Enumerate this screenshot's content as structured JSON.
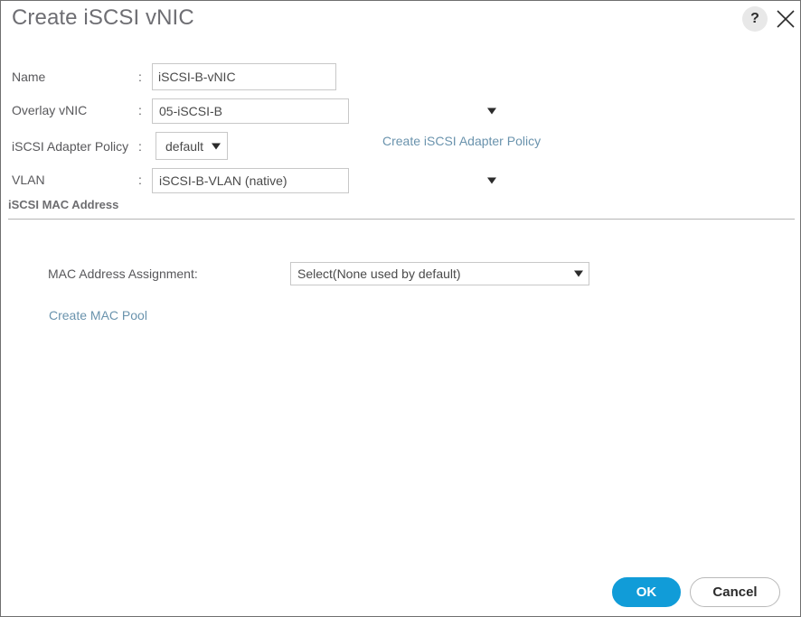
{
  "dialog": {
    "title": "Create iSCSI vNIC",
    "help_icon_glyph": "?",
    "help_icon_name": "question-mark-icon",
    "close_icon_name": "close-icon"
  },
  "form": {
    "colon": ":",
    "name": {
      "label": "Name",
      "value": "iSCSI-B-vNIC",
      "placeholder": ""
    },
    "overlay_vnic": {
      "label": "Overlay vNIC",
      "value": "05-iSCSI-B"
    },
    "adapter_policy": {
      "label": "iSCSI Adapter Policy",
      "value": "default"
    },
    "vlan": {
      "label": "VLAN",
      "value": "iSCSI-B-VLAN (native)"
    },
    "adapter_policy_link": "Create iSCSI Adapter Policy"
  },
  "mac_section": {
    "title": "iSCSI MAC Address",
    "assignment_label": "MAC Address Assignment:",
    "assignment_value": "Select(None used by default)",
    "create_pool_link": "Create MAC Pool"
  },
  "footer": {
    "ok_label": "OK",
    "cancel_label": "Cancel"
  },
  "colors": {
    "accent_blue": "#119cd8",
    "link_blue": "#6a93ad",
    "label_gray": "#58585b",
    "title_gray": "#6e6e73",
    "border_gray": "#c8c8c8",
    "divider_gray": "#b5b5b5"
  }
}
